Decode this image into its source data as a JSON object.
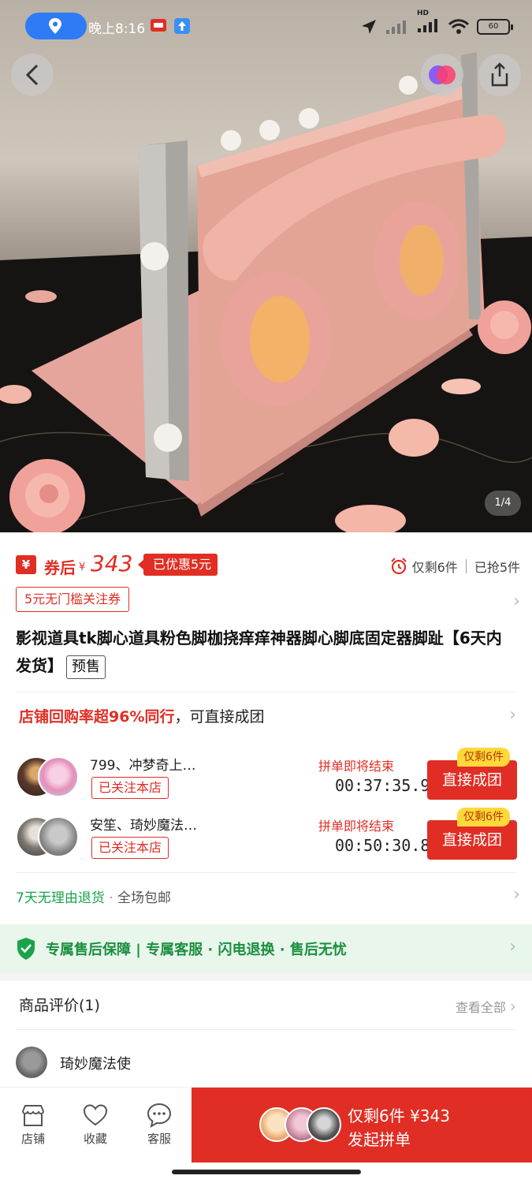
{
  "status_bar": {
    "time": "晚上8:16",
    "hd_label": "HD",
    "battery": "60"
  },
  "hero": {
    "page_indicator": "1/4",
    "icons": [
      "back-icon",
      "share-icon",
      "brand-badge-icon",
      "location-pin-icon"
    ]
  },
  "price": {
    "coupon_badge": "¥",
    "prefix": "券后",
    "currency": "¥",
    "value": "343",
    "discount": "已优惠5元",
    "stock_left": "仅剩6件",
    "sold": "已抢5件"
  },
  "coupon": {
    "label": "5元无门槛关注券"
  },
  "product": {
    "title": "影视道具tk脚心道具粉色脚枷挠痒痒神器脚心脚底固定器脚趾【6天内发货】",
    "presale": "预售"
  },
  "groups": {
    "repurchase_highlight": "店铺回购率超96%同行",
    "repurchase_suffix": "，可直接成团",
    "list": [
      {
        "name": "799、冲梦奇上…",
        "tag": "已关注本店",
        "ending": "拼单即将结束",
        "timer": "00:37:35.9",
        "button": "直接成团",
        "remain": "仅剩6件"
      },
      {
        "name": "安笙、琦妙魔法…",
        "tag": "已关注本店",
        "ending": "拼单即将结束",
        "timer": "00:50:30.8",
        "button": "直接成团",
        "remain": "仅剩6件"
      }
    ]
  },
  "service": {
    "returns": "7天无理由退货",
    "dot": "·",
    "shipping": "全场包邮",
    "guarantee": "专属售后保障 | 专属客服 · 闪电退换 · 售后无忧"
  },
  "reviews": {
    "title": "商品评价(1)",
    "view_all": "查看全部",
    "first_reviewer": "琦妙魔法使"
  },
  "bottom_bar": {
    "store": "店铺",
    "favorite": "收藏",
    "service": "客服",
    "cta_line1": "仅剩6件 ¥343",
    "cta_line2": "发起拼单"
  },
  "colors": {
    "accent": "#e02e24",
    "guarantee_green": "#1a8f3f",
    "guarantee_bg": "#e9f6ec"
  }
}
